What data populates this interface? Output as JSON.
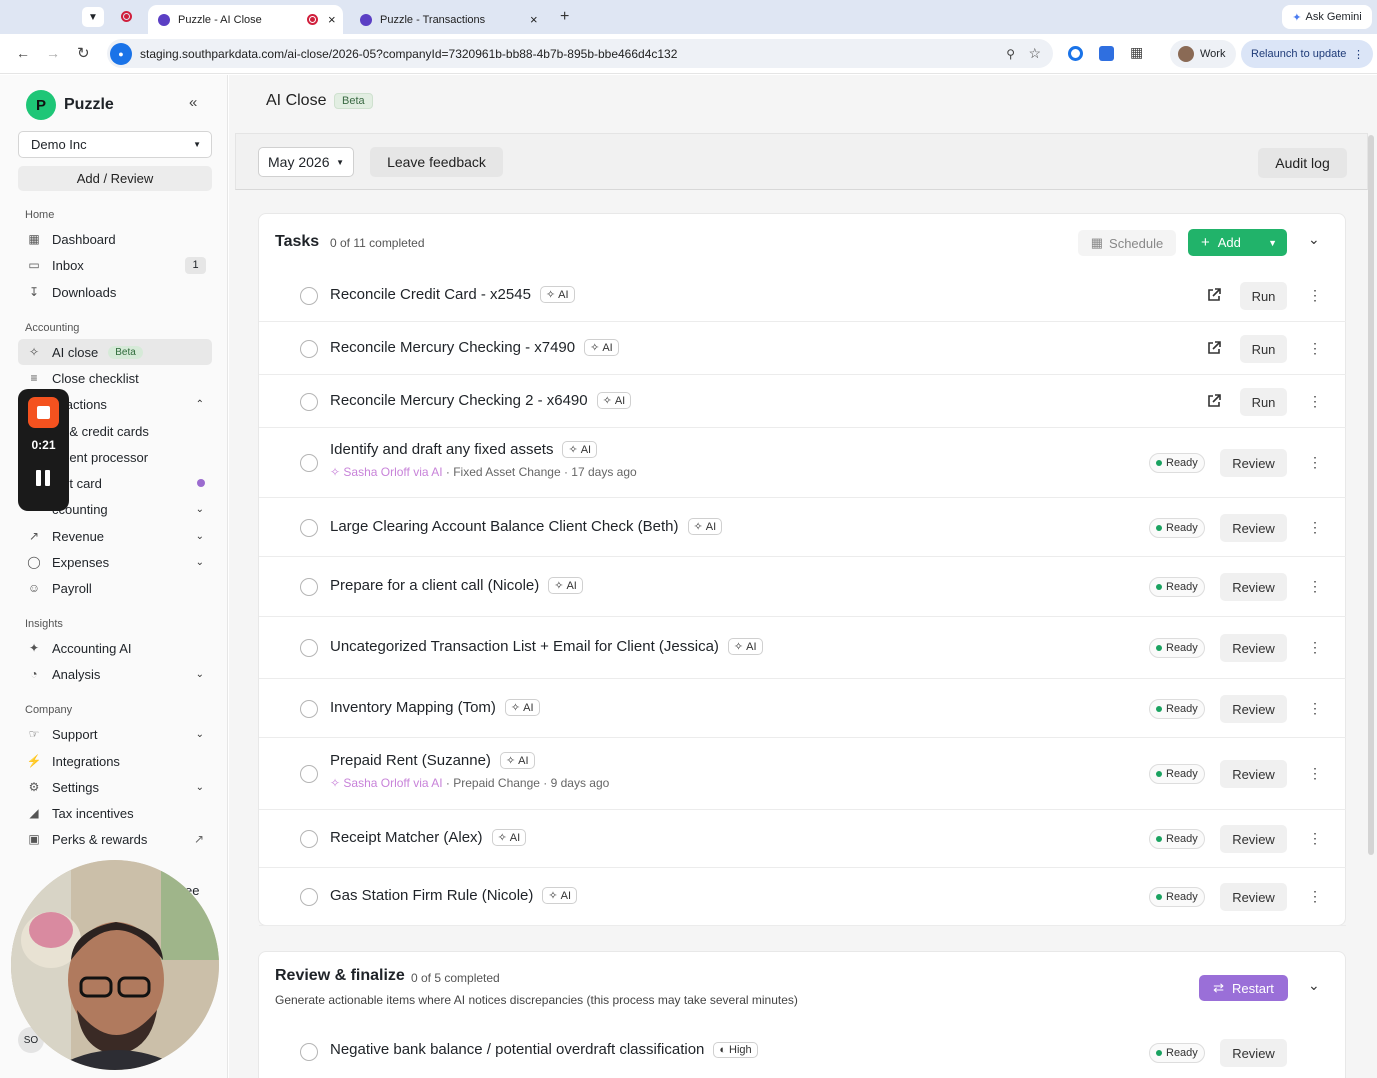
{
  "browser": {
    "tabs": [
      {
        "title": "Puzzle - AI Close",
        "active": true
      },
      {
        "title": "Puzzle - Transactions",
        "active": false
      }
    ],
    "url": "staging.southparkdata.com/ai-close/2026-05?companyId=7320961b-bb88-4b7b-895b-bbe466d4c132",
    "ask_gemini": "Ask Gemini",
    "profile": "Work",
    "relaunch": "Relaunch to update"
  },
  "sidebar": {
    "brand": "Puzzle",
    "company": "Demo Inc",
    "add_review": "Add / Review",
    "sections": {
      "home": "Home",
      "accounting": "Accounting",
      "insights": "Insights",
      "company": "Company"
    },
    "items": {
      "dashboard": "Dashboard",
      "inbox": "Inbox",
      "inbox_count": "1",
      "downloads": "Downloads",
      "ai_close": "AI close",
      "ai_close_badge": "Beta",
      "close_checklist": "Close checklist",
      "transactions": "nsactions",
      "bank_cards": "nk & credit cards",
      "payment_processor": "yment processor",
      "credit_card": "edit card",
      "accounting": "ccounting",
      "revenue": "Revenue",
      "expenses": "Expenses",
      "payroll": "Payroll",
      "accounting_ai": "Accounting AI",
      "analysis": "Analysis",
      "support": "Support",
      "integrations": "Integrations",
      "settings": "Settings",
      "tax_incentives": "Tax incentives",
      "perks": "Perks & rewards",
      "partial_bottom": "ee",
      "avatar_initials": "SO"
    }
  },
  "recording": {
    "time": "0:21"
  },
  "header": {
    "title": "AI Close",
    "badge": "Beta"
  },
  "toolbar": {
    "period": "May 2026",
    "feedback": "Leave feedback",
    "audit": "Audit log"
  },
  "tasks": {
    "title": "Tasks",
    "progress": "0 of 11 completed",
    "schedule": "Schedule",
    "add": "Add",
    "items": [
      {
        "title": "Reconcile Credit Card - x2545",
        "ai": "AI",
        "action": "Run"
      },
      {
        "title": "Reconcile Mercury Checking - x7490",
        "ai": "AI",
        "action": "Run"
      },
      {
        "title": "Reconcile Mercury Checking 2 - x6490",
        "ai": "AI",
        "action": "Run"
      },
      {
        "title": "Identify and draft any fixed assets",
        "ai": "AI",
        "sub_by": "Sasha Orloff via AI",
        "sub_rest": " · Fixed Asset Change · 17 days ago",
        "status": "Ready",
        "action": "Review"
      },
      {
        "title": "Large Clearing Account Balance Client Check (Beth)",
        "ai": "AI",
        "status": "Ready",
        "action": "Review"
      },
      {
        "title": "Prepare for a client call (Nicole)",
        "ai": "AI",
        "status": "Ready",
        "action": "Review"
      },
      {
        "title": "Uncategorized Transaction List + Email for Client (Jessica)",
        "ai": "AI",
        "status": "Ready",
        "action": "Review"
      },
      {
        "title": "Inventory Mapping (Tom)",
        "ai": "AI",
        "status": "Ready",
        "action": "Review"
      },
      {
        "title": "Prepaid Rent (Suzanne)",
        "ai": "AI",
        "sub_by": "Sasha Orloff via AI",
        "sub_rest": " · Prepaid Change · 9 days ago",
        "status": "Ready",
        "action": "Review"
      },
      {
        "title": "Receipt Matcher (Alex)",
        "ai": "AI",
        "status": "Ready",
        "action": "Review"
      },
      {
        "title": "Gas Station Firm Rule (Nicole)",
        "ai": "AI",
        "status": "Ready",
        "action": "Review"
      }
    ]
  },
  "review": {
    "title": "Review & finalize",
    "progress": "0 of 5 completed",
    "description": "Generate actionable items where AI notices discrepancies (this process may take several minutes)",
    "restart": "Restart",
    "items": [
      {
        "title": "Negative bank balance / potential overdraft classification",
        "priority": "High",
        "status": "Ready",
        "action": "Review"
      }
    ]
  }
}
